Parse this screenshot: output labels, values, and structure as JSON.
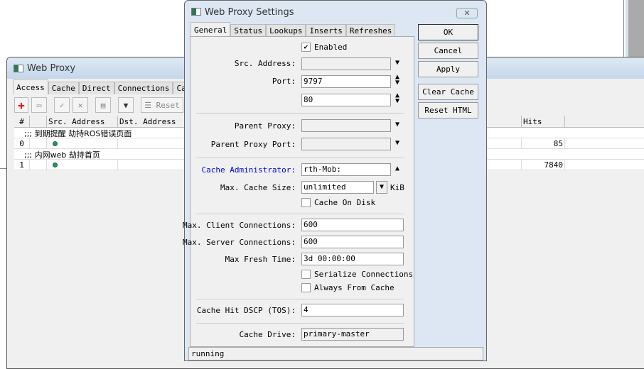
{
  "web_proxy": {
    "title": "Web Proxy",
    "tabs": [
      "Access",
      "Cache",
      "Direct",
      "Connections",
      "Cac"
    ],
    "toolbar": {
      "reset": "Reset"
    },
    "columns": [
      "#",
      "",
      "Src. Address",
      "Dst. Address",
      "Hits"
    ],
    "rows": [
      {
        "comment": ";;; 到期提醒 劫持ROS错误页面",
        "num": "0",
        "hits": "85"
      },
      {
        "comment": ";;; 内网web 劫持首页",
        "num": "1",
        "hits": "7840"
      }
    ]
  },
  "settings": {
    "title": "Web Proxy Settings",
    "tabs": [
      "General",
      "Status",
      "Lookups",
      "Inserts",
      "Refreshes"
    ],
    "enabled_label": "Enabled",
    "enabled": true,
    "src_address_label": "Src. Address:",
    "src_address": "",
    "port_label": "Port:",
    "port": "9797",
    "port2": "80",
    "parent_proxy_label": "Parent Proxy:",
    "parent_proxy": "",
    "parent_proxy_port_label": "Parent Proxy Port:",
    "parent_proxy_port": "",
    "cache_admin_label": "Cache Administrator:",
    "cache_admin": "rth-Mob:",
    "max_cache_size_label": "Max. Cache Size:",
    "max_cache_size": "unlimited",
    "kib": "KiB",
    "cache_on_disk_label": "Cache On Disk",
    "max_client_label": "Max. Client Connections:",
    "max_client": "600",
    "max_server_label": "Max. Server Connections:",
    "max_server": "600",
    "max_fresh_label": "Max Fresh Time:",
    "max_fresh": "3d 00:00:00",
    "serialize_label": "Serialize Connections",
    "always_label": "Always From Cache",
    "dscp_label": "Cache Hit DSCP (TOS):",
    "dscp": "4",
    "drive_label": "Cache Drive:",
    "drive": "primary-master",
    "buttons": {
      "ok": "OK",
      "cancel": "Cancel",
      "apply": "Apply",
      "clear": "Clear Cache",
      "reset": "Reset HTML"
    },
    "status": "running"
  },
  "close_glyph": "✕"
}
